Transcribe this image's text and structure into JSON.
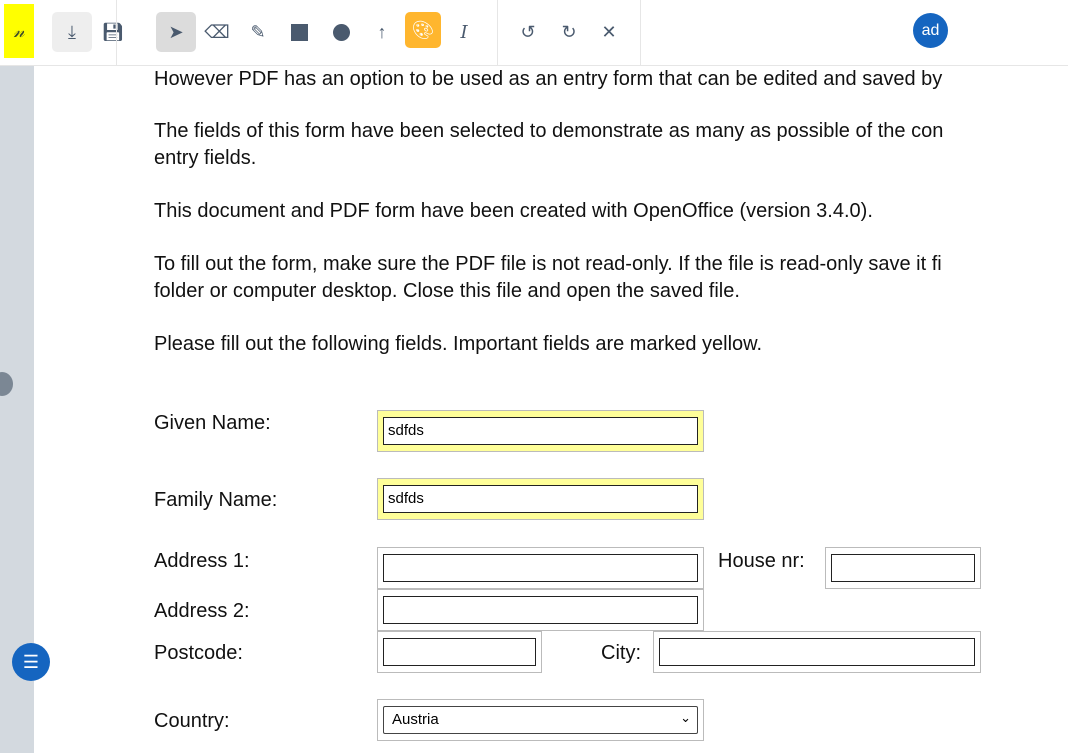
{
  "toolbar": {
    "avatar": "ad",
    "accent": "#ffb62e",
    "signature_highlight": "#ffff00"
  },
  "doc": {
    "paragraphs": [
      "However PDF has an option to be used as an entry form that can be edited and saved by",
      "The fields of this form have been selected to demonstrate as many as possible of the con",
      "entry fields.",
      "This document and PDF form have been created with OpenOffice (version 3.4.0).",
      "To fill out the form, make sure the PDF file is not read-only. If the file is read-only save it fi",
      "folder or computer desktop. Close this file and open the saved file.",
      "Please fill out the following fields. Important fields are marked yellow."
    ],
    "form": {
      "given_name_label": "Given Name:",
      "given_name": "sdfds",
      "family_name_label": "Family Name:",
      "family_name": "sdfds",
      "address1_label": "Address 1:",
      "address1": "",
      "house_nr_label": "House nr:",
      "house_nr": "",
      "address2_label": "Address 2:",
      "address2": "",
      "postcode_label": "Postcode:",
      "postcode": "",
      "city_label": "City:",
      "city": "",
      "country_label": "Country:",
      "country": "Austria"
    }
  }
}
